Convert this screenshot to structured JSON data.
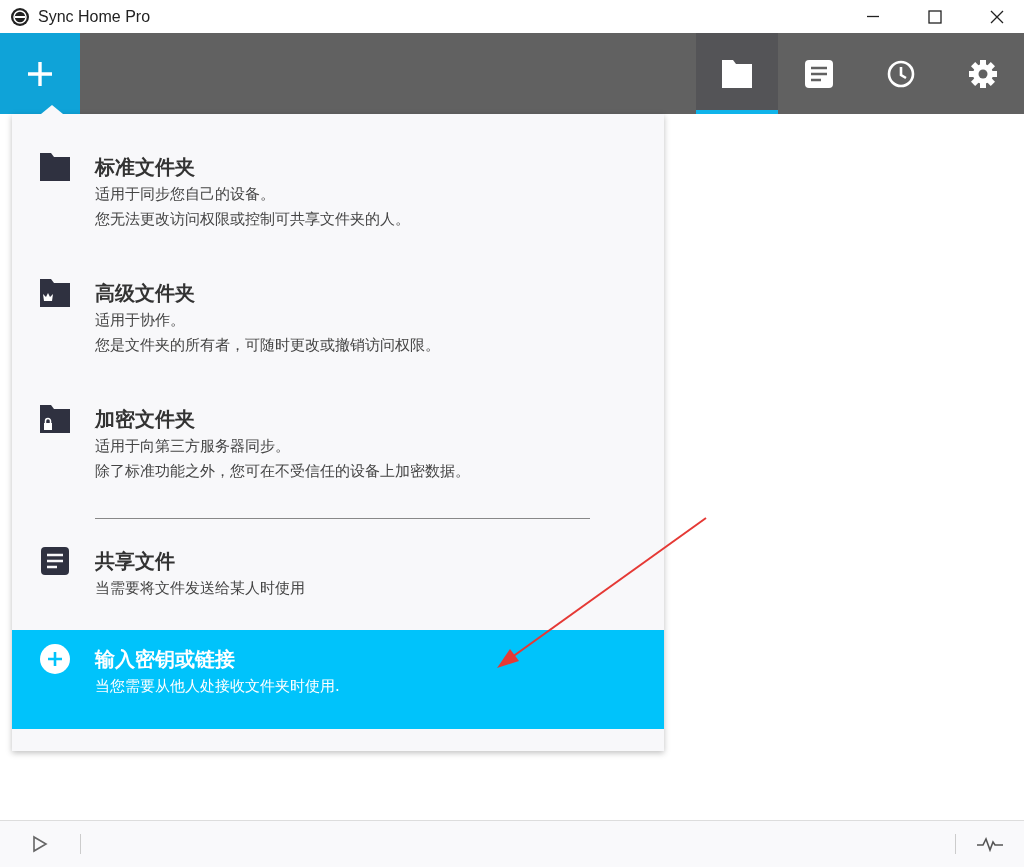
{
  "window": {
    "title": "Sync Home Pro"
  },
  "toolbar": {
    "tabs": [
      {
        "kind": "folder",
        "selected": true
      },
      {
        "kind": "document",
        "selected": false
      },
      {
        "kind": "clock",
        "selected": false
      },
      {
        "kind": "gear",
        "selected": false
      }
    ]
  },
  "menu": {
    "items": [
      {
        "kind": "folder",
        "title": "标准文件夹",
        "lines": [
          "适用于同步您自己的设备。",
          "您无法更改访问权限或控制可共享文件夹的人。"
        ],
        "selected": false
      },
      {
        "kind": "crown-folder",
        "title": "高级文件夹",
        "lines": [
          "适用于协作。",
          "您是文件夹的所有者，可随时更改或撤销访问权限。"
        ],
        "selected": false
      },
      {
        "kind": "lock-folder",
        "title": "加密文件夹",
        "lines": [
          "适用于向第三方服务器同步。",
          "除了标准功能之外，您可在不受信任的设备上加密数据。"
        ],
        "selected": false
      },
      {
        "kind": "divider"
      },
      {
        "kind": "document",
        "title": "共享文件",
        "lines": [
          "当需要将文件发送给某人时使用"
        ],
        "selected": false
      },
      {
        "kind": "plus",
        "title": "输入密钥或链接",
        "lines": [
          "当您需要从他人处接收文件夹时使用."
        ],
        "selected": true
      }
    ]
  }
}
